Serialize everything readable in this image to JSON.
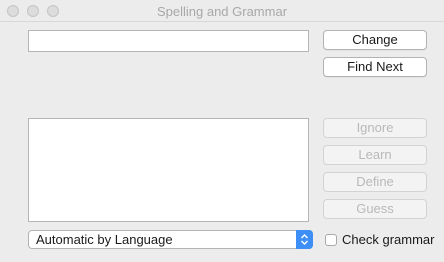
{
  "window": {
    "title": "Spelling and Grammar"
  },
  "word_field": {
    "value": ""
  },
  "buttons": {
    "change": "Change",
    "find_next": "Find Next",
    "ignore": "Ignore",
    "learn": "Learn",
    "define": "Define",
    "guess": "Guess"
  },
  "guess_list": {
    "items": []
  },
  "language_popup": {
    "selected": "Automatic by Language"
  },
  "check_grammar": {
    "label": "Check grammar",
    "checked": false
  },
  "colors": {
    "accent": "#3d8ff7",
    "disabled_text": "#b9b9b9"
  }
}
